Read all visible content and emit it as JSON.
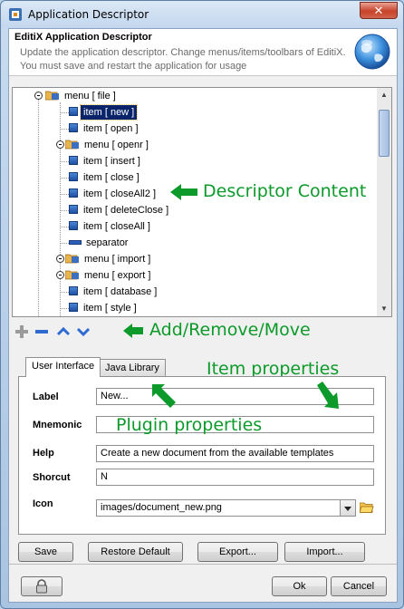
{
  "window": {
    "title": "Application Descriptor",
    "close_glyph": "✕"
  },
  "header": {
    "title": "EditiX Application Descriptor",
    "description": "Update the application descriptor. Change menus/items/toolbars of EditiX. You must save and restart the application for usage"
  },
  "tree": {
    "rows": [
      {
        "kind": "menu",
        "label": "menu [ file ]"
      },
      {
        "kind": "item",
        "label": "item [ new ]",
        "selected": true
      },
      {
        "kind": "item",
        "label": "item [ open ]"
      },
      {
        "kind": "menu",
        "label": "menu [ openr ]"
      },
      {
        "kind": "item",
        "label": "item [ insert ]"
      },
      {
        "kind": "item",
        "label": "item [ close ]"
      },
      {
        "kind": "item",
        "label": "item [ closeAll2 ]"
      },
      {
        "kind": "item",
        "label": "item [ deleteClose ]"
      },
      {
        "kind": "item",
        "label": "item [ closeAll ]"
      },
      {
        "kind": "separator",
        "label": "separator"
      },
      {
        "kind": "menu",
        "label": "menu [ import ]"
      },
      {
        "kind": "menu",
        "label": "menu [ export ]"
      },
      {
        "kind": "item",
        "label": "item [ database ]"
      },
      {
        "kind": "item",
        "label": "item [ style ]"
      }
    ]
  },
  "annotations": {
    "descriptor_content": "Descriptor Content",
    "add_remove_move": "Add/Remove/Move",
    "item_properties": "Item properties",
    "plugin_properties": "Plugin properties"
  },
  "tabs": [
    {
      "label": "User Interface",
      "active": true
    },
    {
      "label": "Java Library",
      "active": false
    }
  ],
  "form": {
    "label": {
      "caption": "Label",
      "value": "New..."
    },
    "mnemonic": {
      "caption": "Mnemonic",
      "value": ""
    },
    "help": {
      "caption": "Help",
      "value": "Create a new document from the available templates"
    },
    "shortcut": {
      "caption": "Shorcut",
      "value": "N"
    },
    "icon": {
      "caption": "Icon",
      "value": "images/document_new.png"
    }
  },
  "actions": {
    "save": "Save",
    "restore_default": "Restore Default",
    "export": "Export...",
    "import": "Import..."
  },
  "footer": {
    "ok": "Ok",
    "cancel": "Cancel"
  },
  "colors": {
    "annotation_green": "#0c9a2a",
    "selection": "#0a246a"
  }
}
